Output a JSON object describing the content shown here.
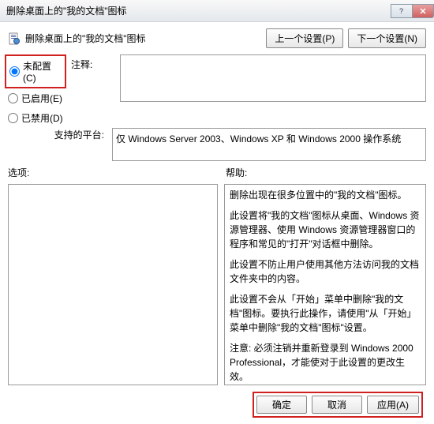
{
  "window": {
    "title": "删除桌面上的\"我的文档\"图标"
  },
  "header": {
    "title": "删除桌面上的\"我的文档\"图标",
    "prev": "上一个设置(P)",
    "next": "下一个设置(N)"
  },
  "radios": {
    "not_configured": "未配置(C)",
    "enabled": "已启用(E)",
    "disabled": "已禁用(D)"
  },
  "labels": {
    "comment": "注释:",
    "platform": "支持的平台:",
    "options": "选项:",
    "help": "帮助:"
  },
  "platform_text": "仅 Windows Server 2003、Windows XP 和 Windows 2000 操作系统",
  "help": {
    "p1": "删除出现在很多位置中的\"我的文档\"图标。",
    "p2": "此设置将\"我的文档\"图标从桌面、Windows 资源管理器、使用 Windows 资源管理器窗口的程序和常见的\"打开\"对话框中删除。",
    "p3": "此设置不防止用户使用其他方法访问我的文档文件夹中的内容。",
    "p4": "此设置不会从「开始」菜单中删除\"我的文档\"图标。要执行此操作，请使用\"从「开始」菜单中删除\"我的文档\"图标\"设置。",
    "p5": "注意: 必须注销并重新登录到 Windows 2000 Professional，才能使对于此设置的更改生效。"
  },
  "footer": {
    "ok": "确定",
    "cancel": "取消",
    "apply": "应用(A)"
  }
}
